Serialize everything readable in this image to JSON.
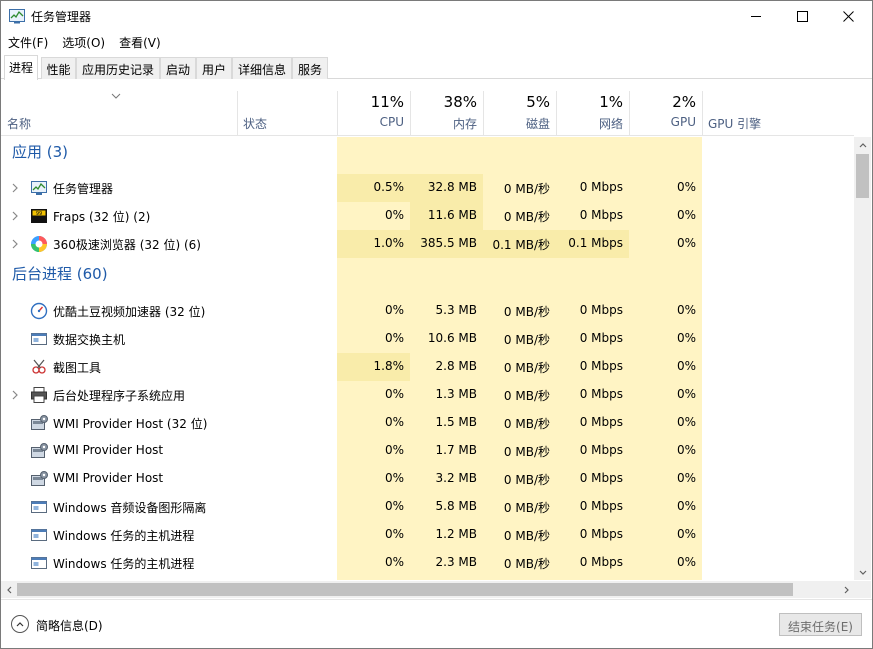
{
  "window": {
    "title": "任务管理器"
  },
  "menu": [
    "文件(F)",
    "选项(O)",
    "查看(V)"
  ],
  "tabs": [
    "进程",
    "性能",
    "应用历史记录",
    "启动",
    "用户",
    "详细信息",
    "服务"
  ],
  "header": {
    "name": "名称",
    "status": "状态",
    "cpu": {
      "pct": "11%",
      "label": "CPU"
    },
    "memory": {
      "pct": "38%",
      "label": "内存"
    },
    "disk": {
      "pct": "5%",
      "label": "磁盘"
    },
    "network": {
      "pct": "1%",
      "label": "网络"
    },
    "gpu": {
      "pct": "2%",
      "label": "GPU"
    },
    "gpu_engine": "GPU 引擎"
  },
  "groups": {
    "apps": "应用 (3)",
    "background": "后台进程 (60)"
  },
  "apps": [
    {
      "name": "任务管理器",
      "icon": "taskmgr-icon",
      "cpu": "0.5%",
      "mem": "32.8 MB",
      "disk": "0 MB/秒",
      "net": "0 Mbps",
      "gpu": "0%"
    },
    {
      "name": "Fraps (32 位) (2)",
      "icon": "fraps-icon",
      "cpu": "0%",
      "mem": "11.6 MB",
      "disk": "0 MB/秒",
      "net": "0 Mbps",
      "gpu": "0%"
    },
    {
      "name": "360极速浏览器 (32 位) (6)",
      "icon": "browser-360-icon",
      "cpu": "1.0%",
      "mem": "385.5 MB",
      "disk": "0.1 MB/秒",
      "net": "0.1 Mbps",
      "gpu": "0%"
    }
  ],
  "background": [
    {
      "name": "优酷土豆视频加速器 (32 位)",
      "icon": "accelerator-icon",
      "expand": false,
      "cpu": "0%",
      "mem": "5.3 MB",
      "disk": "0 MB/秒",
      "net": "0 Mbps",
      "gpu": "0%"
    },
    {
      "name": "数据交换主机",
      "icon": "window-app-icon",
      "expand": false,
      "cpu": "0%",
      "mem": "10.6 MB",
      "disk": "0 MB/秒",
      "net": "0 Mbps",
      "gpu": "0%"
    },
    {
      "name": "截图工具",
      "icon": "snipping-tool-icon",
      "expand": false,
      "cpu": "1.8%",
      "mem": "2.8 MB",
      "disk": "0 MB/秒",
      "net": "0 Mbps",
      "gpu": "0%"
    },
    {
      "name": "后台处理程序子系统应用",
      "icon": "printer-icon",
      "expand": true,
      "cpu": "0%",
      "mem": "1.3 MB",
      "disk": "0 MB/秒",
      "net": "0 Mbps",
      "gpu": "0%"
    },
    {
      "name": "WMI Provider Host (32 位)",
      "icon": "wmi-host-icon",
      "expand": false,
      "cpu": "0%",
      "mem": "1.5 MB",
      "disk": "0 MB/秒",
      "net": "0 Mbps",
      "gpu": "0%"
    },
    {
      "name": "WMI Provider Host",
      "icon": "wmi-host-icon",
      "expand": false,
      "cpu": "0%",
      "mem": "1.7 MB",
      "disk": "0 MB/秒",
      "net": "0 Mbps",
      "gpu": "0%"
    },
    {
      "name": "WMI Provider Host",
      "icon": "wmi-host-icon",
      "expand": false,
      "cpu": "0%",
      "mem": "3.2 MB",
      "disk": "0 MB/秒",
      "net": "0 Mbps",
      "gpu": "0%"
    },
    {
      "name": "Windows 音频设备图形隔离",
      "icon": "window-app-icon",
      "expand": false,
      "cpu": "0%",
      "mem": "5.8 MB",
      "disk": "0 MB/秒",
      "net": "0 Mbps",
      "gpu": "0%"
    },
    {
      "name": "Windows 任务的主机进程",
      "icon": "window-app-icon",
      "expand": false,
      "cpu": "0%",
      "mem": "1.2 MB",
      "disk": "0 MB/秒",
      "net": "0 Mbps",
      "gpu": "0%"
    },
    {
      "name": "Windows 任务的主机进程",
      "icon": "window-app-icon",
      "expand": false,
      "cpu": "0%",
      "mem": "2.3 MB",
      "disk": "0 MB/秒",
      "net": "0 Mbps",
      "gpu": "0%"
    }
  ],
  "footer": {
    "fewer_details": "简略信息(D)",
    "end_task": "结束任务(E)"
  },
  "colors": {
    "accent": "#1f5aa8",
    "heat_light": "#fff4c4",
    "heat_mid": "#ffefb0",
    "heat_strong": "#f9ecaa"
  }
}
